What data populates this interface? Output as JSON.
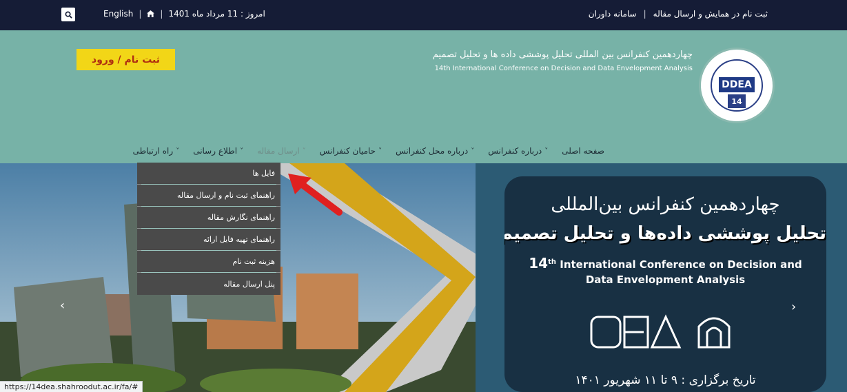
{
  "topbar": {
    "search_icon": "search-icon",
    "language": "English",
    "home_icon": "home-icon",
    "date_text": "امروز : 11 مرداد ماه 1401",
    "register_submit": "ثبت نام در همایش و ارسال مقاله",
    "judges_system": "سامانه داوران",
    "separator": "|"
  },
  "header": {
    "cta_label": "ثبت نام / ورود",
    "title_fa": "چهاردهمین کنفرانس بین المللی تحلیل پوششی داده ها و تحلیل تصمیم",
    "title_en": "14th International Conference on Decision and Data Envelopment Analysis",
    "logo_mark": "DDEA",
    "logo_badge": "14"
  },
  "nav": {
    "items": [
      {
        "label": "صفحه اصلی"
      },
      {
        "label": "درباره کنفرانس"
      },
      {
        "label": "درباره محل کنفرانس"
      },
      {
        "label": "حامیان کنفرانس"
      },
      {
        "label": "ارسال مقاله"
      },
      {
        "label": "اطلاع رسانی"
      },
      {
        "label": "راه ارتباطی"
      }
    ],
    "chevron": "˅"
  },
  "dropdown": {
    "items": [
      "فایل ها",
      "راهنمای ثبت نام و ارسال مقاله",
      "راهنمای نگارش مقاله",
      "راهنمای تهیه فایل ارائه",
      "هزینه ثبت نام",
      "پنل ارسال مقاله"
    ]
  },
  "hero": {
    "poster_title_1": "چهاردهمین کنفرانس بین‌المللی",
    "poster_title_2": "تحلیل پوششی داده‌ها و تحلیل تصمیم",
    "poster_en_num": "14",
    "poster_en_sup": "th",
    "poster_en_rest": "International Conference on Decision and",
    "poster_en_line2": "Data Envelopment Analysis",
    "poster_date": "تاریخ برگزاری : ۹ تا ۱۱ شهریور ۱۴۰۱",
    "prev_icon": "‹",
    "next_icon": "›"
  },
  "status_url": "https://14dea.shahroodut.ac.ir/fa/#",
  "colors": {
    "topbar": "#151c36",
    "header": "#77b2a7",
    "cta_bg": "#f2d617",
    "cta_text": "#b03010",
    "dropdown_bg": "#4a4a4a",
    "annotation_arrow": "#e02020"
  }
}
